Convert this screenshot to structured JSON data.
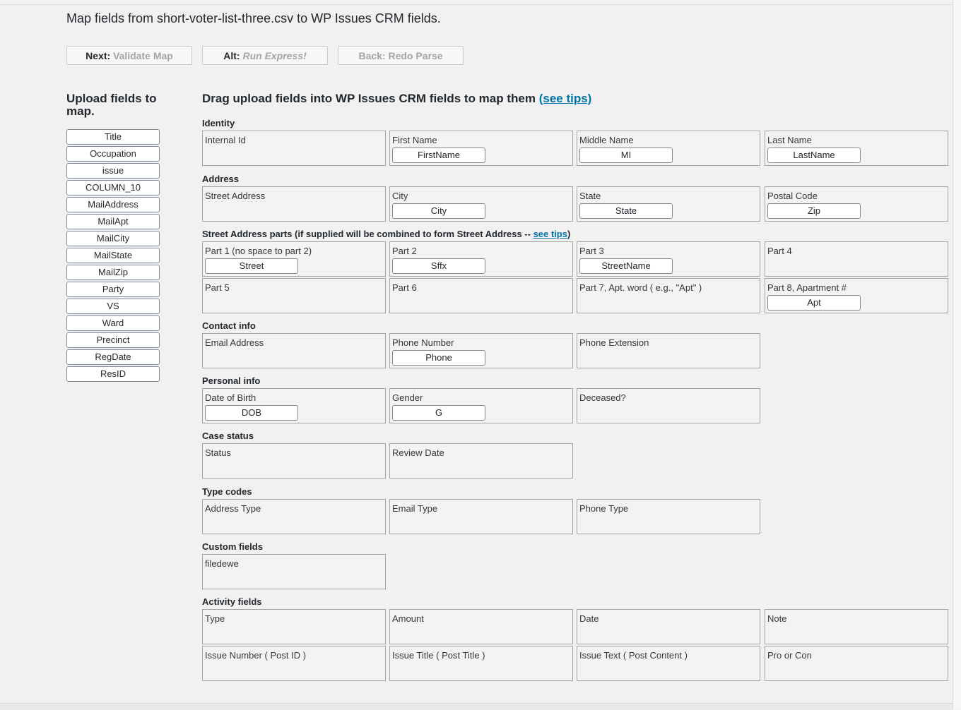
{
  "heading": "Map fields from short-voter-list-three.csv to WP Issues CRM fields.",
  "buttons": [
    {
      "prefix": "Next:",
      "label": "Validate Map"
    },
    {
      "prefix": "Alt:",
      "label": "Run Express!"
    },
    {
      "prefix": "Back:",
      "label": "Redo Parse"
    }
  ],
  "upload_title": "Upload fields to map.",
  "upload_fields": [
    "Title",
    "Occupation",
    "issue",
    "COLUMN_10",
    "MailAddress",
    "MailApt",
    "MailCity",
    "MailState",
    "MailZip",
    "Party",
    "VS",
    "Ward",
    "Precinct",
    "RegDate",
    "ResID"
  ],
  "drag_title": "Drag upload fields into WP Issues CRM fields to map them",
  "drag_tips": "(see tips)",
  "sections": {
    "identity": "Identity",
    "address": "Address",
    "street_parts": "Street Address parts (if supplied will be combined to form Street Address -- ",
    "street_parts_tips": "see tips",
    "street_parts_close": ")",
    "contact": "Contact info",
    "personal": "Personal info",
    "case": "Case status",
    "type_codes": "Type codes",
    "custom": "Custom fields",
    "activity": "Activity fields"
  },
  "fields": {
    "internal_id": {
      "label": "Internal Id",
      "mapped": ""
    },
    "first_name": {
      "label": "First Name",
      "mapped": "FirstName"
    },
    "middle_name": {
      "label": "Middle Name",
      "mapped": "MI"
    },
    "last_name": {
      "label": "Last Name",
      "mapped": "LastName"
    },
    "street_address": {
      "label": "Street Address",
      "mapped": ""
    },
    "city": {
      "label": "City",
      "mapped": "City"
    },
    "state": {
      "label": "State",
      "mapped": "State"
    },
    "postal_code": {
      "label": "Postal Code",
      "mapped": "Zip"
    },
    "part1": {
      "label": "Part 1 (no space to part 2)",
      "mapped": "Street"
    },
    "part2": {
      "label": "Part 2",
      "mapped": "Sffx"
    },
    "part3": {
      "label": "Part 3",
      "mapped": "StreetName"
    },
    "part4": {
      "label": "Part 4",
      "mapped": ""
    },
    "part5": {
      "label": "Part 5",
      "mapped": ""
    },
    "part6": {
      "label": "Part 6",
      "mapped": ""
    },
    "part7": {
      "label": "Part 7, Apt. word ( e.g., \"Apt\" )",
      "mapped": ""
    },
    "part8": {
      "label": "Part 8, Apartment #",
      "mapped": "Apt"
    },
    "email_address": {
      "label": "Email Address",
      "mapped": ""
    },
    "phone_number": {
      "label": "Phone Number",
      "mapped": "Phone"
    },
    "phone_extension": {
      "label": "Phone Extension",
      "mapped": ""
    },
    "dob": {
      "label": "Date of Birth",
      "mapped": "DOB"
    },
    "gender": {
      "label": "Gender",
      "mapped": "G"
    },
    "deceased": {
      "label": "Deceased?",
      "mapped": ""
    },
    "status": {
      "label": "Status",
      "mapped": ""
    },
    "review_date": {
      "label": "Review Date",
      "mapped": ""
    },
    "address_type": {
      "label": "Address Type",
      "mapped": ""
    },
    "email_type": {
      "label": "Email Type",
      "mapped": ""
    },
    "phone_type": {
      "label": "Phone Type",
      "mapped": ""
    },
    "filedewe": {
      "label": "filedewe",
      "mapped": ""
    },
    "activity_type": {
      "label": "Type",
      "mapped": ""
    },
    "amount": {
      "label": "Amount",
      "mapped": ""
    },
    "activity_date": {
      "label": "Date",
      "mapped": ""
    },
    "note": {
      "label": "Note",
      "mapped": ""
    },
    "issue_number": {
      "label": "Issue Number ( Post ID )",
      "mapped": ""
    },
    "issue_title": {
      "label": "Issue Title ( Post Title )",
      "mapped": ""
    },
    "issue_text": {
      "label": "Issue Text ( Post Content )",
      "mapped": ""
    },
    "pro_con": {
      "label": "Pro or Con",
      "mapped": ""
    }
  }
}
